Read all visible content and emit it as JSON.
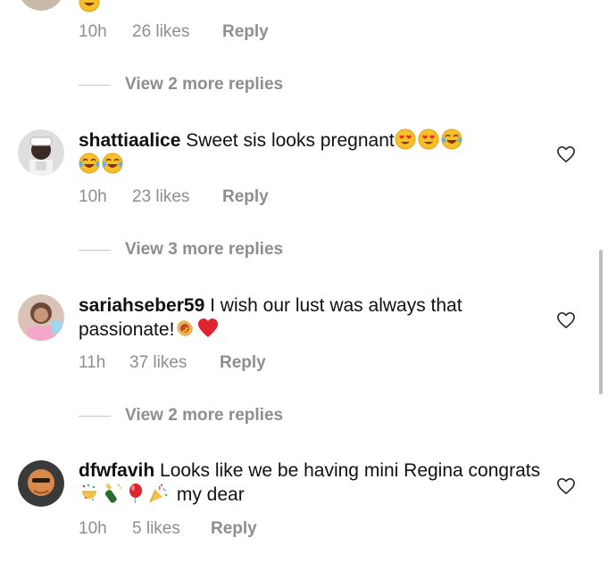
{
  "top_comment": {
    "time": "10h",
    "likes": "26 likes",
    "reply_label": "Reply",
    "view_replies": "View 2 more replies"
  },
  "comments": [
    {
      "username": "shattiaalice",
      "text": "Sweet sis looks pregnant",
      "emojis": [
        "heart-eyes-emoji",
        "heart-eyes-emoji",
        "tears-of-joy-emoji",
        "tears-of-joy-emoji",
        "tears-of-joy-emoji"
      ],
      "time": "10h",
      "likes": "23 likes",
      "reply_label": "Reply",
      "view_replies": "View 3 more replies"
    },
    {
      "username": "sariahseber59",
      "text": "I wish our lust was always that passionate!",
      "emojis": [
        "hot-dog-emoji",
        "red-heart-emoji"
      ],
      "time": "11h",
      "likes": "37 likes",
      "reply_label": "Reply",
      "view_replies": "View 2 more replies"
    },
    {
      "username": "dfwfavih",
      "text_before": "Looks like we be having mini Regina congrats",
      "emojis": [
        "confetti-ball-emoji",
        "champagne-emoji",
        "balloon-emoji",
        "party-popper-emoji"
      ],
      "text_after": "my dear",
      "time": "10h",
      "likes": "5 likes",
      "reply_label": "Reply"
    }
  ],
  "icons": {
    "like": "heart-outline-icon"
  },
  "colors": {
    "text": "#111111",
    "secondary": "#8e8e8e",
    "divider": "#c7c7c7"
  }
}
